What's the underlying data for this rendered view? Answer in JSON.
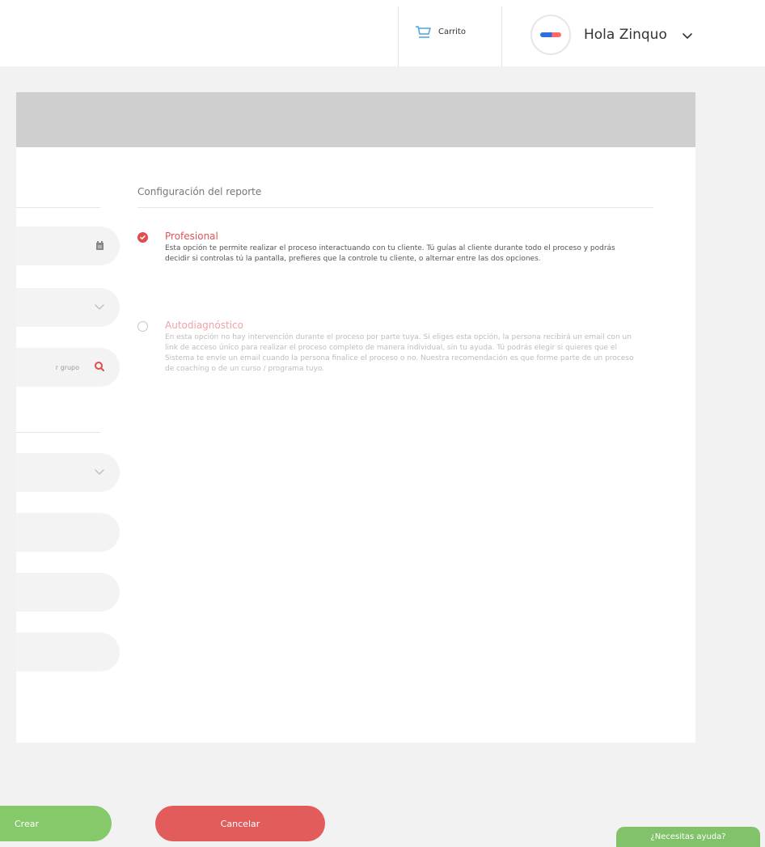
{
  "topbar": {
    "cart_label": "Carrito",
    "greeting": "Hola Zinquo"
  },
  "icons": {
    "cart": "cart-icon",
    "avatar": "avatar-logo",
    "chevron": "chevron-down-icon",
    "calendar": "calendar-icon",
    "search": "search-icon"
  },
  "form_left": {
    "search_placeholder_partial": "r grupo"
  },
  "report_config": {
    "title": "Configuración del reporte",
    "options": [
      {
        "title": "Profesional",
        "description": "Esta opción te permite realizar el proceso interactuando con tu cliente. Tú guías al cliente durante todo el proceso y podrás decidir si controlas tú la pantalla, prefieres que la controle tu cliente, o alternar entre las dos opciones.",
        "selected": true
      },
      {
        "title": "Autodiagnóstico",
        "description": "En esta opción no hay intervención durante el proceso por parte tuya. Si eliges esta opción, la persona recibirá un email con un link de acceso único para realizar el proceso completo de manera individual, sin tu ayuda. Tú podrás elegir si quieres que el Sistema te envíe un email cuando la persona finalice el proceso o no. Nuestra recomendación es que forme parte de un proceso de coaching o de un curso / programa tuyo.",
        "selected": false
      }
    ]
  },
  "actions": {
    "create_label": "Crear",
    "cancel_label": "Cancelar"
  },
  "help": {
    "label": "¿Necesitas ayuda?"
  },
  "colors": {
    "accent_red": "#e24d4d",
    "green": "#86c96b",
    "header_gray": "#cfcfcf"
  }
}
